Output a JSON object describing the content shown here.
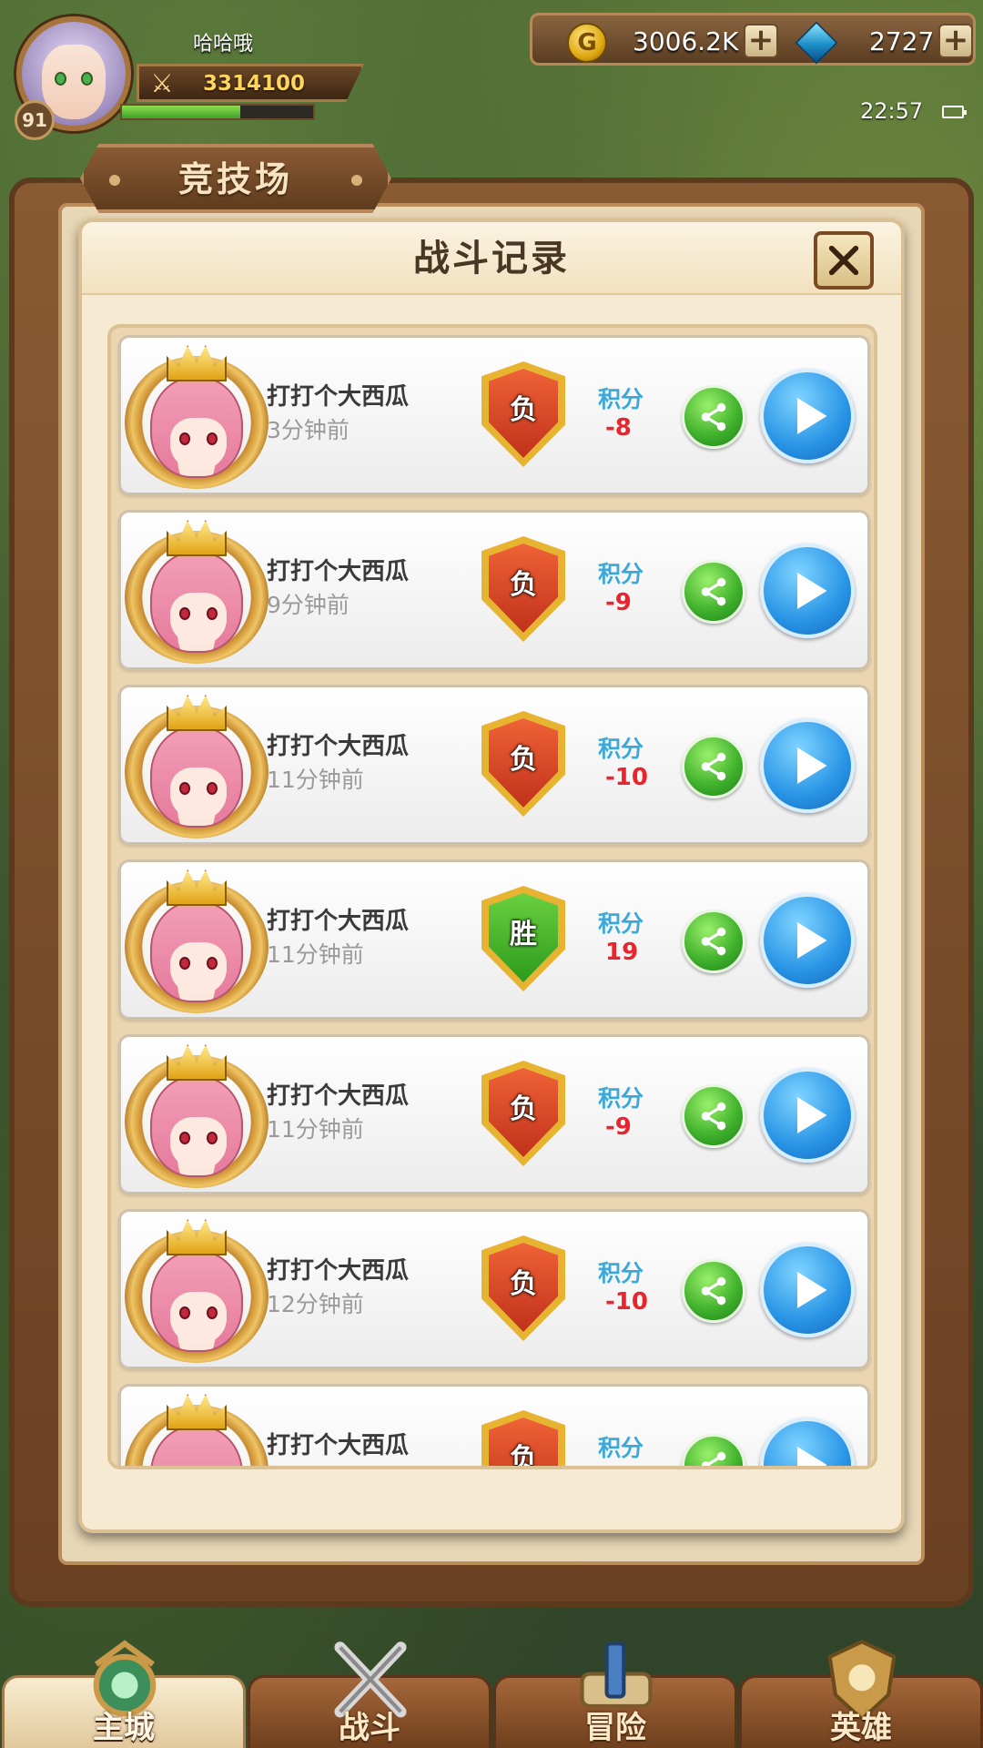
{
  "hud": {
    "player_name": "哈哈哦",
    "level": "91",
    "power": "3314100",
    "xp_fraction": 0.62,
    "gold": "3006.2K",
    "gems": "2727",
    "time": "22:57"
  },
  "arena_tab": "竞技场",
  "modal": {
    "title": "战斗记录",
    "records": [
      {
        "name": "打打个大西瓜",
        "time": "3分钟前",
        "result": "负",
        "score_label": "积分",
        "score": "-8"
      },
      {
        "name": "打打个大西瓜",
        "time": "9分钟前",
        "result": "负",
        "score_label": "积分",
        "score": "-9"
      },
      {
        "name": "打打个大西瓜",
        "time": "11分钟前",
        "result": "负",
        "score_label": "积分",
        "score": "-10"
      },
      {
        "name": "打打个大西瓜",
        "time": "11分钟前",
        "result": "胜",
        "score_label": "积分",
        "score": "19"
      },
      {
        "name": "打打个大西瓜",
        "time": "11分钟前",
        "result": "负",
        "score_label": "积分",
        "score": "-9"
      },
      {
        "name": "打打个大西瓜",
        "time": "12分钟前",
        "result": "负",
        "score_label": "积分",
        "score": "-10"
      },
      {
        "name": "打打个大西瓜",
        "time": "",
        "result": "负",
        "score_label": "积分",
        "score": ""
      }
    ]
  },
  "bottom_nav": [
    {
      "label": "主城",
      "active": true
    },
    {
      "label": "战斗",
      "active": false
    },
    {
      "label": "冒险",
      "active": false
    },
    {
      "label": "英雄",
      "active": false
    }
  ],
  "colors": {
    "lose": "#e04a26",
    "win": "#3cae2a",
    "score_label": "#3aa8d8",
    "score_value": "#e8242c"
  },
  "icons": [
    "gold-coin-icon",
    "gem-icon",
    "plus-icon",
    "crossed-swords-icon",
    "close-icon",
    "share-icon",
    "play-icon",
    "battery-icon"
  ]
}
